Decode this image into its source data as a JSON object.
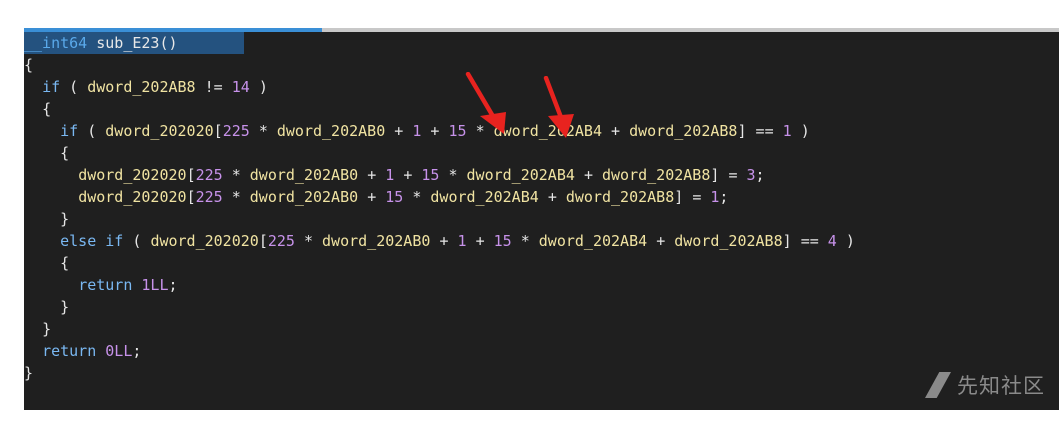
{
  "code": {
    "signature": {
      "type": "__int64",
      "name": "sub_E23()"
    },
    "lines": [
      "{",
      "  if ( dword_202AB8 != 14 )",
      "  {",
      "    if ( dword_202020[225 * dword_202AB0 + 1 + 15 * dword_202AB4 + dword_202AB8] == 1 )",
      "    {",
      "      dword_202020[225 * dword_202AB0 + 1 + 15 * dword_202AB4 + dword_202AB8] = 3;",
      "      dword_202020[225 * dword_202AB0 + 15 * dword_202AB4 + dword_202AB8] = 1;",
      "    }",
      "    else if ( dword_202020[225 * dword_202AB0 + 1 + 15 * dword_202AB4 + dword_202AB8] == 4 )",
      "    {",
      "      return 1LL;",
      "    }",
      "  }",
      "  return 0LL;",
      "}"
    ]
  },
  "annotations": {
    "arrow_color": "#e8231f",
    "arrows": [
      "arrow-to-1",
      "arrow-to-15"
    ]
  },
  "watermark": {
    "text": "先知社区"
  },
  "colors": {
    "background": "#1f1f1f",
    "keyword": "#7ab8f2",
    "identifier": "#f0e3a2",
    "number": "#c792ea",
    "selection": "#24527f"
  }
}
